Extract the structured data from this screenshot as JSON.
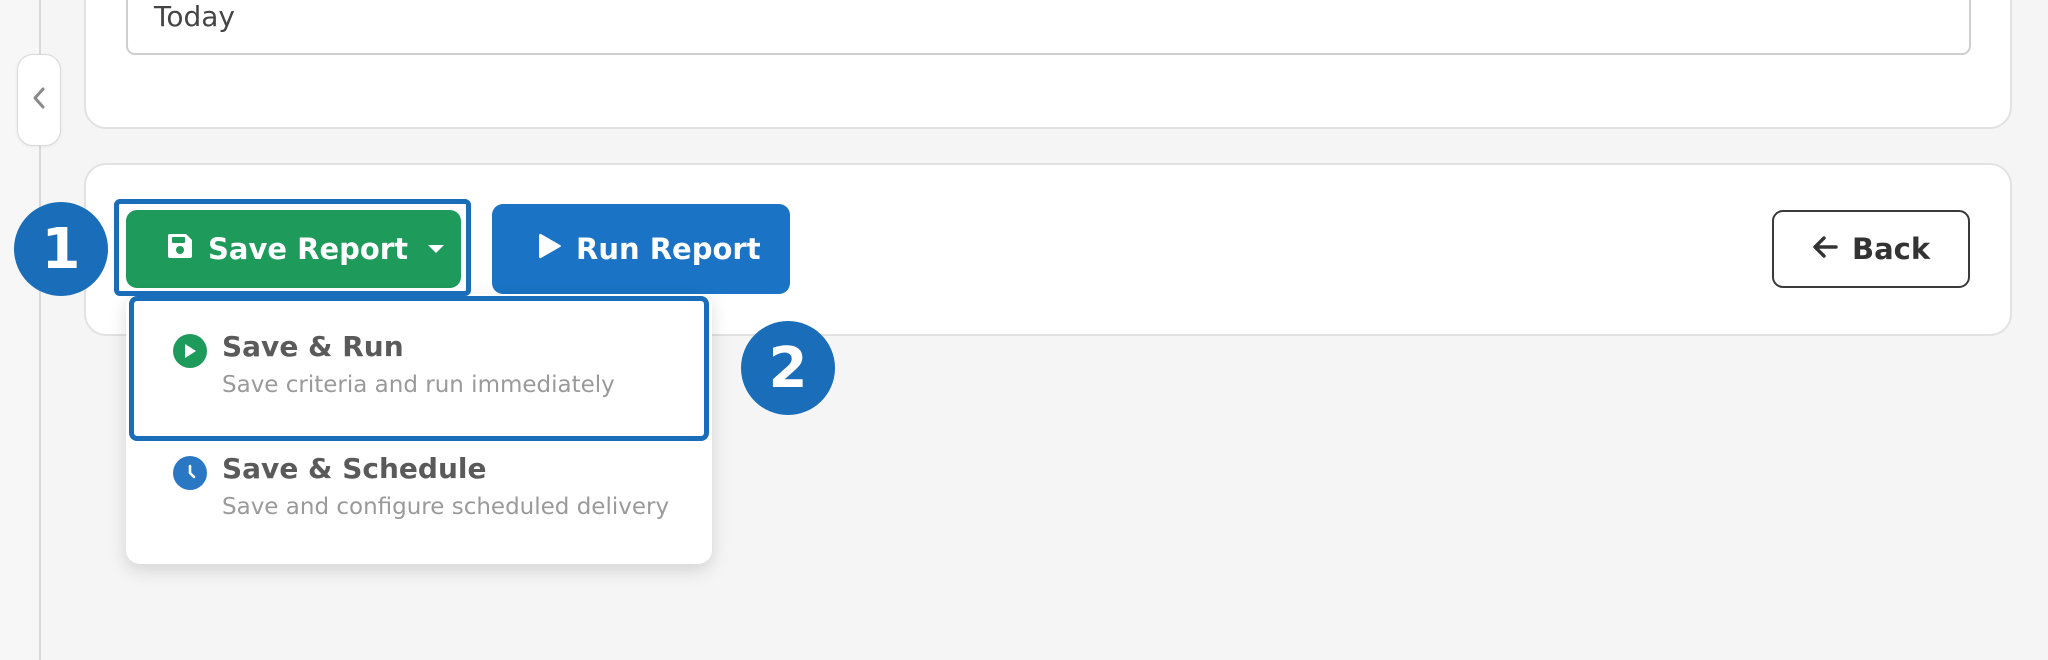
{
  "filters": {
    "date_value": "Today"
  },
  "actions": {
    "save_label": "Save Report",
    "run_label": "Run Report",
    "back_label": "Back"
  },
  "save_menu": {
    "items": [
      {
        "title": "Save & Run",
        "description": "Save criteria and run immediately",
        "icon": "play-circle-icon"
      },
      {
        "title": "Save & Schedule",
        "description": "Save and configure scheduled delivery",
        "icon": "clock-icon"
      }
    ]
  },
  "annotations": {
    "step_1": "1",
    "step_2": "2"
  },
  "colors": {
    "save_green": "#1e9a5a",
    "run_blue": "#1a73c4",
    "highlight_blue": "#1a6db8",
    "background": "#f5f5f5"
  }
}
